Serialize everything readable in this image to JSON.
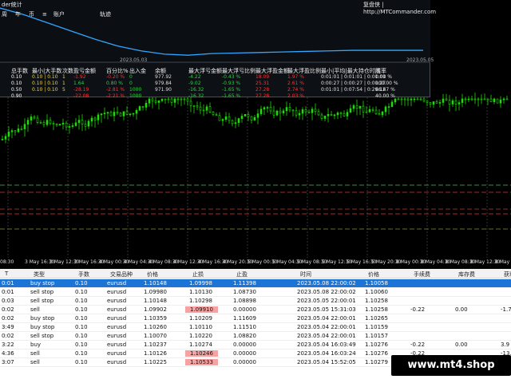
{
  "panel": {
    "title": "der统计",
    "brand": "复盘侠 | http://MTCommander.com",
    "menu": [
      "周",
      "年",
      "币",
      "≡",
      "账户",
      "轨迹"
    ],
    "date_left": "2023.05.03",
    "date_right": "2023.05.05",
    "curve": [
      0.97,
      0.85,
      0.7,
      0.55,
      0.4,
      0.27,
      0.18,
      0.12,
      0.1,
      0.13,
      0.14,
      0.15,
      0.16,
      0.17,
      0.18,
      0.19,
      0.19,
      0.19,
      0.19
    ],
    "headers": [
      "总手数",
      "最小|大手数",
      "次数",
      "盈亏金额",
      "百分比%",
      "出入金",
      "余额",
      "最大浮亏金额",
      "最大浮亏比例",
      "最大浮盈金额",
      "最大浮盈比例",
      "最小|平均|最大持仓时间",
      "胜率"
    ],
    "rows": [
      [
        "0.10",
        "0.10 | 0.10",
        "1",
        "-1.92",
        "-0.20 %",
        "0",
        "977.92",
        "-4.22",
        "-0.43 %",
        "18.09",
        "1.97 %",
        "0:01:01 | 0:01:01 | 0:01:01",
        "0.00 %"
      ],
      [
        "0.10",
        "0.10 | 0.10",
        "1",
        "1.64",
        "0.80 %",
        "0",
        "979.84",
        "-9.02",
        "-0.93 %",
        "25.31",
        "2.61 %",
        "0:00:27 | 0:00:27 | 0:00:27",
        "100.00 %"
      ],
      [
        "0.50",
        "0.10 | 0.10",
        "5",
        "-28.19",
        "-2.81 %",
        "1000",
        "971.90",
        "-16.32",
        "-1.65 %",
        "27.28",
        "2.74 %",
        "0:01:01 | 0:07:54 | 0:29:12",
        "66.67 %"
      ],
      [
        "0.90",
        "",
        "",
        "-22.08",
        "-2.21 %",
        "1000",
        "",
        "-16.32",
        "-1.65 %",
        "27.28",
        "2.03 %",
        "",
        "40.00 %"
      ]
    ]
  },
  "time_axis": [
    "08:30",
    "3 May 16:30",
    "3 May 12:30",
    "3 May 16:30",
    "4 May 00:30",
    "4 May 04:30",
    "4 May 08:30",
    "4 May 12:30",
    "4 May 16:30",
    "4 May 20:30",
    "5 May 00:30",
    "5 May 04:30",
    "5 May 08:30",
    "5 May 12:30",
    "5 May 16:30",
    "5 May 20:30",
    "8 May 00:30",
    "8 May 04:30",
    "8 May 08:30",
    "8 May 12:30",
    "8 May 16:30"
  ],
  "grid": {
    "headers": [
      "T",
      "类型",
      "手数",
      "交易品种",
      "价格",
      "止损",
      "止盈",
      "时间",
      "价格",
      "手续费",
      "库存费",
      "获利"
    ],
    "rows": [
      [
        "0:01",
        "buy stop",
        "0.10",
        "eurusd",
        "1.10148",
        "1.09998",
        "1.11398",
        "2023.05.08 22:00:02",
        "1.10058",
        "",
        "",
        ""
      ],
      [
        "0:01",
        "sell stop",
        "0.10",
        "eurusd",
        "1.09980",
        "1.10130",
        "1.08730",
        "2023.05.08 22:00:02",
        "1.10060",
        "",
        "",
        ""
      ],
      [
        "0:03",
        "sell stop",
        "0.10",
        "eurusd",
        "1.10148",
        "1.10298",
        "1.08898",
        "2023.05.05 22:00:01",
        "1.10258",
        "",
        "",
        ""
      ],
      [
        "0:02",
        "sell",
        "0.10",
        "eurusd",
        "1.09902",
        "1.09910",
        "0.00000",
        "2023.05.05 15:31:03",
        "1.10258",
        "-0.22",
        "0.00",
        "-1.7"
      ],
      [
        "0:02",
        "buy stop",
        "0.10",
        "eurusd",
        "1.10359",
        "1.10209",
        "1.11609",
        "2023.05.04 22:00:01",
        "1.10265",
        "",
        "",
        ""
      ],
      [
        "3:49",
        "buy stop",
        "0.10",
        "eurusd",
        "1.10260",
        "1.10110",
        "1.11510",
        "2023.05.04 22:00:01",
        "1.10159",
        "",
        "",
        ""
      ],
      [
        "0:02",
        "sell stop",
        "0.10",
        "eurusd",
        "1.10070",
        "1.10220",
        "1.08820",
        "2023.05.04 22:00:01",
        "1.10157",
        "",
        "",
        ""
      ],
      [
        "3:22",
        "buy",
        "0.10",
        "eurusd",
        "1.10237",
        "1.10274",
        "0.00000",
        "2023.05.04 16:03:49",
        "1.10276",
        "-0.22",
        "0.00",
        "3.9"
      ],
      [
        "4:36",
        "sell",
        "0.10",
        "eurusd",
        "1.10126",
        "1.10246",
        "0.00000",
        "2023.05.04 16:03:24",
        "1.10276",
        "-0.22",
        "",
        "-13.0"
      ],
      [
        "3:07",
        "sell",
        "0.10",
        "eurusd",
        "1.10225",
        "1.10533",
        "0.00000",
        "2023.05.04 15:52:05",
        "1.10279",
        "",
        "",
        ""
      ]
    ],
    "pink_rows": [
      3,
      8,
      9
    ]
  },
  "watermark": "www.mt4.shop",
  "colors": {
    "bull": "#25d80f",
    "selected": "#1b74d6",
    "loss": "#ff2b2b",
    "profit": "#2bd23f",
    "curve": "#31a7ff"
  }
}
